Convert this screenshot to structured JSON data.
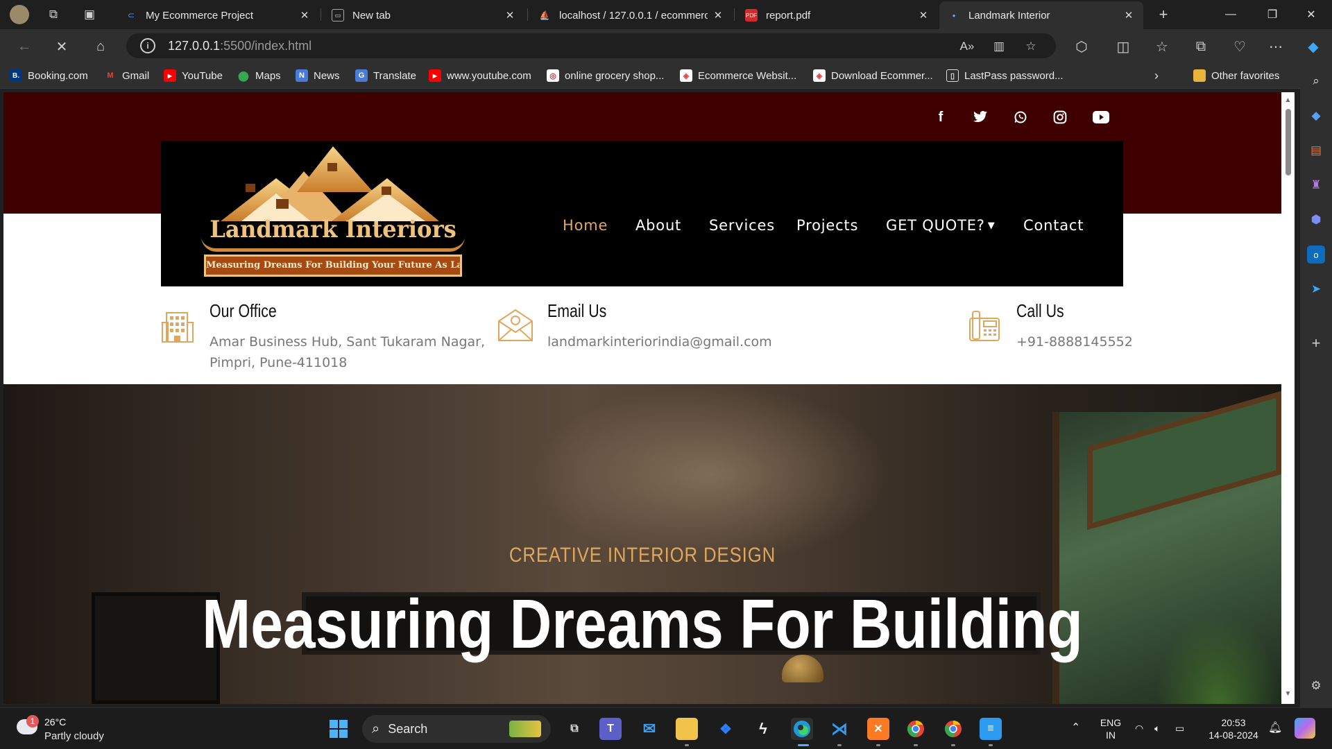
{
  "browser": {
    "tabs": [
      {
        "title": "My Ecommerce Project",
        "icon": "copilot-icon",
        "active": false
      },
      {
        "title": "New tab",
        "icon": "newtab-icon",
        "active": false
      },
      {
        "title": "localhost / 127.0.0.1 / ecommerc",
        "icon": "phpmyadmin-icon",
        "active": false
      },
      {
        "title": "report.pdf",
        "icon": "pdf-icon",
        "active": false
      },
      {
        "title": "Landmark Interior",
        "icon": "loading-icon",
        "active": true
      }
    ],
    "url_host": "127.0.0.1",
    "url_rest": ":5500/index.html",
    "favorites": [
      {
        "label": "Booking.com",
        "glyph": "B.",
        "color": "#003580"
      },
      {
        "label": "Gmail",
        "glyph": "M",
        "color": "#ea4335"
      },
      {
        "label": "YouTube",
        "glyph": "▶",
        "color": "#ff0000"
      },
      {
        "label": "Maps",
        "glyph": "●",
        "color": "#34a853"
      },
      {
        "label": "News",
        "glyph": "N",
        "color": "#4a7bd8"
      },
      {
        "label": "Translate",
        "glyph": "G",
        "color": "#4a7bd8"
      },
      {
        "label": "www.youtube.com",
        "glyph": "▶",
        "color": "#ff0000"
      },
      {
        "label": "online grocery shop...",
        "glyph": "◎",
        "color": "#ffffff"
      },
      {
        "label": "Ecommerce Websit...",
        "glyph": "◈",
        "color": "#e64646"
      },
      {
        "label": "Download Ecommer...",
        "glyph": "◈",
        "color": "#e64646"
      },
      {
        "label": "LastPass password...",
        "glyph": "▯",
        "color": "#2f2f2f"
      }
    ],
    "other_favorites": "Other favorites"
  },
  "site": {
    "nav": [
      "Home",
      "About",
      "Services",
      "Projects",
      "GET QUOTE?",
      "Contact"
    ],
    "logo_title": "Landmark Interiors",
    "logo_tagline": "Measuring Dreams For Building Your Future As Landmark",
    "info": [
      {
        "title": "Our Office",
        "value": "Amar Business Hub, Sant Tukaram Nagar, Pimpri, Pune-411018",
        "icon": "building-icon"
      },
      {
        "title": "Email Us",
        "value": "landmarkinteriorindia@gmail.com",
        "icon": "envelope-icon"
      },
      {
        "title": "Call Us",
        "value": "+91-8888145552",
        "icon": "phone-icon"
      }
    ],
    "hero_sub": "CREATIVE INTERIOR DESIGN",
    "hero_title": "Measuring Dreams For Building",
    "colors": {
      "topstrip": "#3e0000",
      "accent": "#e5a660",
      "navbox": "#000000"
    }
  },
  "taskbar": {
    "weather_temp": "26°C",
    "weather_desc": "Partly cloudy",
    "weather_badge": "1",
    "search_label": "Search",
    "lang_top": "ENG",
    "lang_bottom": "IN",
    "time": "20:53",
    "date": "14-08-2024"
  }
}
